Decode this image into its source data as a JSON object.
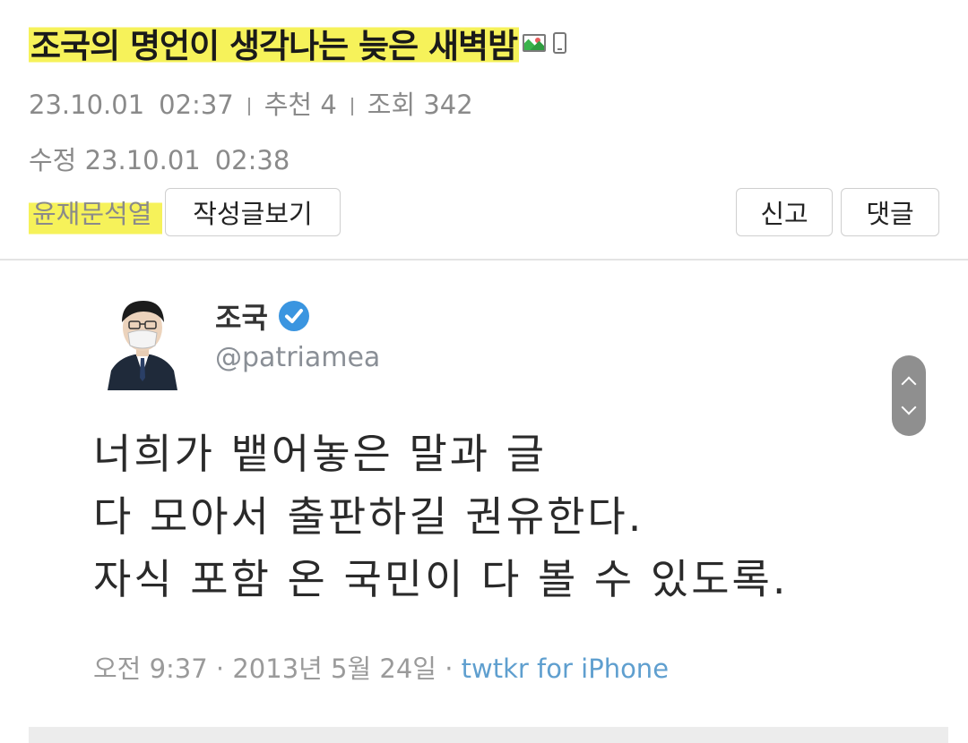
{
  "post": {
    "title": "조국의 명언이 생각나는 늦은 새벽밤",
    "title_icons": [
      "image-icon",
      "mobile-icon"
    ],
    "date": "23.10.01",
    "time": "02:37",
    "recommend_label": "추천",
    "recommend_count": "4",
    "views_label": "조회",
    "views_count": "342",
    "edited_label": "수정",
    "edited_date": "23.10.01",
    "edited_time": "02:38",
    "author": "윤재문석열"
  },
  "buttons": {
    "view_posts": "작성글보기",
    "report": "신고",
    "comment": "댓글"
  },
  "tweet": {
    "name": "조국",
    "handle": "@patriamea",
    "lines": [
      "너희가 뱉어놓은 말과 글",
      "다 모아서 출판하길 권유한다.",
      "자식 포함 온 국민이 다 볼 수 있도록."
    ],
    "footer_time": "오전 9:37 · 2013년 5월 24일 · ",
    "footer_source": "twtkr for iPhone"
  },
  "colors": {
    "highlight": "#f6f25a",
    "meta_gray": "#8a8a8a",
    "verified_blue": "#3a95e0",
    "tweet_source": "#5f9fcf"
  }
}
